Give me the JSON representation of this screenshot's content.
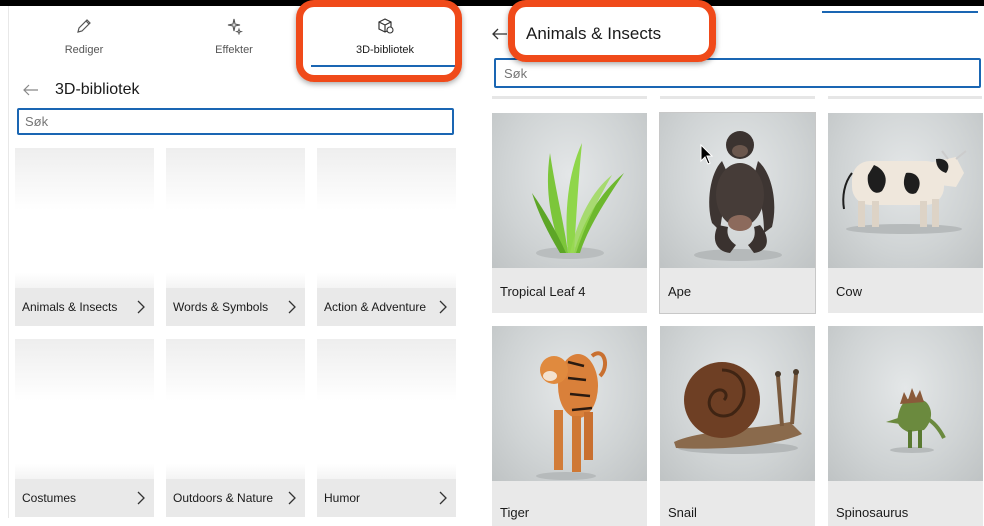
{
  "tabs": [
    {
      "label": "Rediger",
      "icon": "pencil-icon"
    },
    {
      "label": "Effekter",
      "icon": "sparkle-icon"
    },
    {
      "label": "3D-bibliotek",
      "icon": "3d-cube-icon",
      "active": true
    }
  ],
  "library": {
    "title": "3D-bibliotek",
    "search_placeholder": "Søk",
    "categories": [
      {
        "label": "Animals & Insects"
      },
      {
        "label": "Words & Symbols"
      },
      {
        "label": "Action & Adventure"
      },
      {
        "label": "Costumes"
      },
      {
        "label": "Outdoors & Nature"
      },
      {
        "label": "Humor"
      }
    ]
  },
  "category_view": {
    "title": "Animals & Insects",
    "search_placeholder": "Søk",
    "models": [
      {
        "label": "Tropical Leaf 4"
      },
      {
        "label": "Ape"
      },
      {
        "label": "Cow"
      },
      {
        "label": "Tiger"
      },
      {
        "label": "Snail"
      },
      {
        "label": "Spinosaurus"
      }
    ]
  },
  "colors": {
    "accent": "#1a66b3",
    "highlight": "#f04a1a"
  }
}
